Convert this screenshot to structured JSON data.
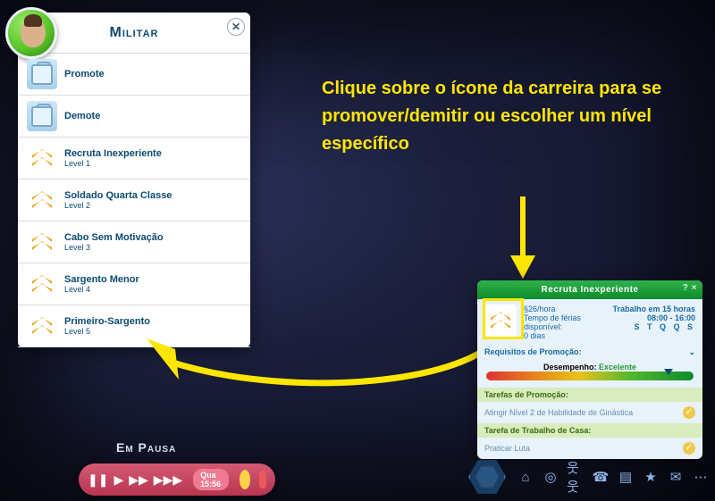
{
  "career_panel": {
    "title": "Militar",
    "items": [
      {
        "name": "Promote",
        "level": "",
        "icon": "suitcase"
      },
      {
        "name": "Demote",
        "level": "",
        "icon": "suitcase"
      },
      {
        "name": "Recruta Inexperiente",
        "level": "Level 1",
        "icon": "chevron"
      },
      {
        "name": "Soldado Quarta Classe",
        "level": "Level 2",
        "icon": "chevron"
      },
      {
        "name": "Cabo Sem Motivação",
        "level": "Level 3",
        "icon": "chevron"
      },
      {
        "name": "Sargento Menor",
        "level": "Level 4",
        "icon": "chevron"
      },
      {
        "name": "Primeiro-Sargento",
        "level": "Level 5",
        "icon": "chevron"
      }
    ]
  },
  "annotation": {
    "text": "Clique sobre o ícone da carreira para se promover/demitir ou escolher um nível específico"
  },
  "info_panel": {
    "title": "Recruta Inexperiente",
    "help": "?  ×",
    "rate": "§26/hora",
    "vacation": "Tempo de férias disponível:",
    "days": "0 dias",
    "work_in": "Trabalho em 15 horas",
    "hours": "08:00 - 16:00",
    "days_row": "S T Q Q S",
    "req_head": "Requisitos de Promoção:",
    "perf_label": "Desempenho:",
    "perf_value": "Excelente",
    "promo_head": "Tarefas de Promoção:",
    "promo_body": "Atingir Nível 2 de Habilidade de Ginástica",
    "home_head": "Tarefa de Trabalho de Casa:",
    "home_body": "Praticar Luta"
  },
  "bottombar": {
    "pause": "Em Pausa",
    "day": "Qua 15:56"
  }
}
